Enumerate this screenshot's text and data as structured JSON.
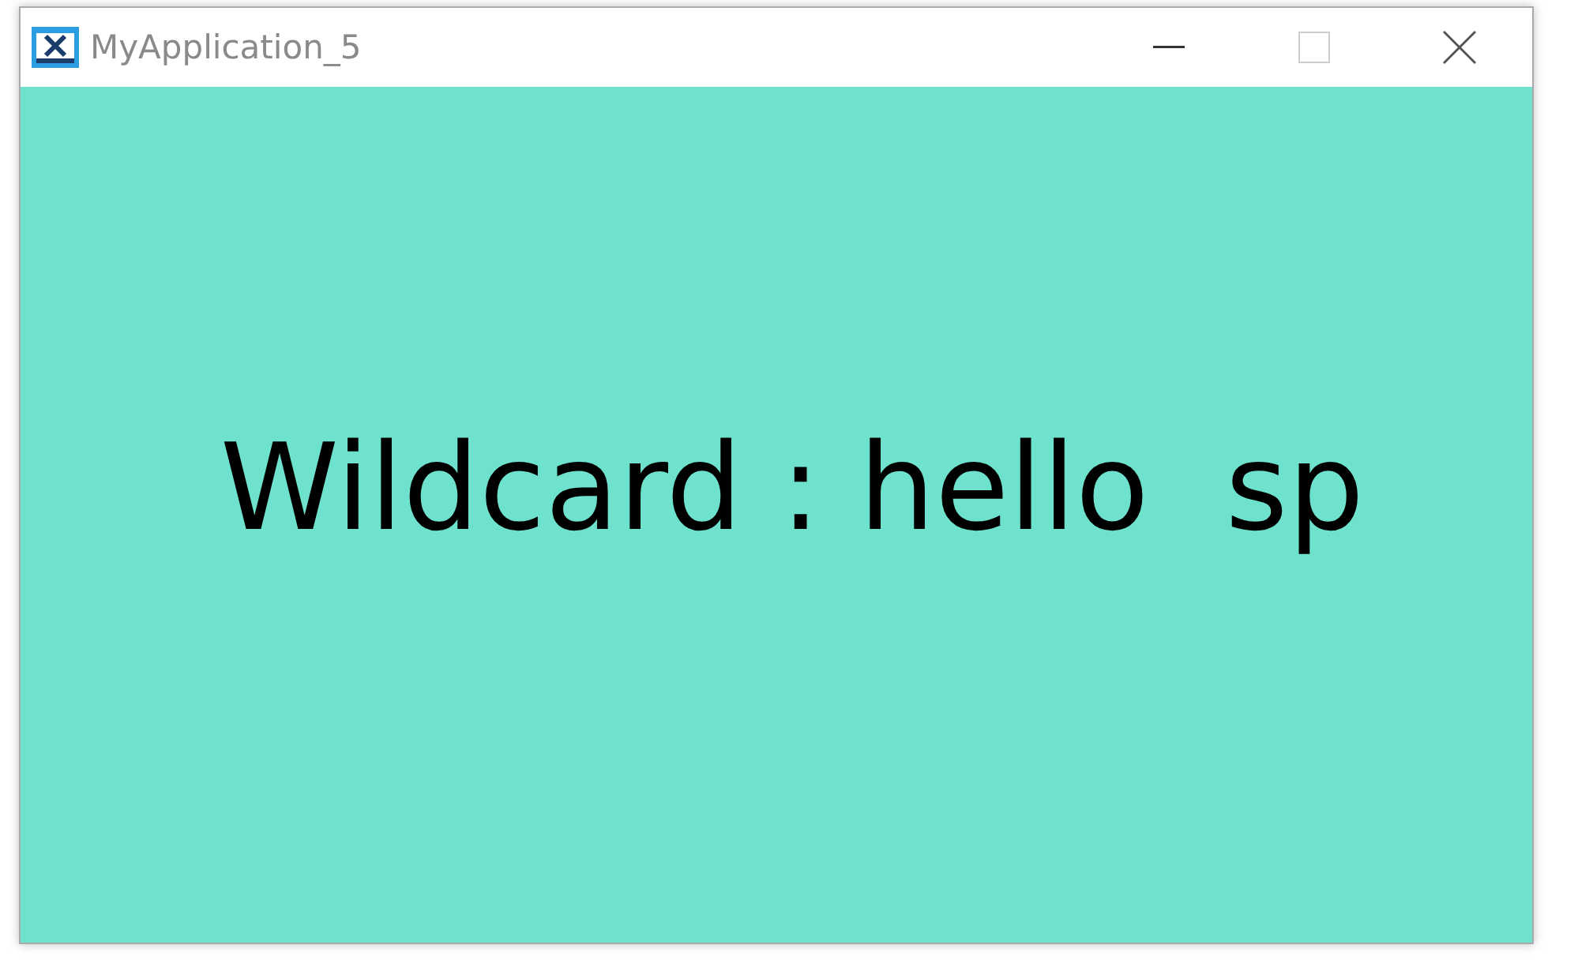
{
  "window": {
    "title": "MyApplication_5"
  },
  "content": {
    "text": "Wildcard : hello  sp"
  }
}
